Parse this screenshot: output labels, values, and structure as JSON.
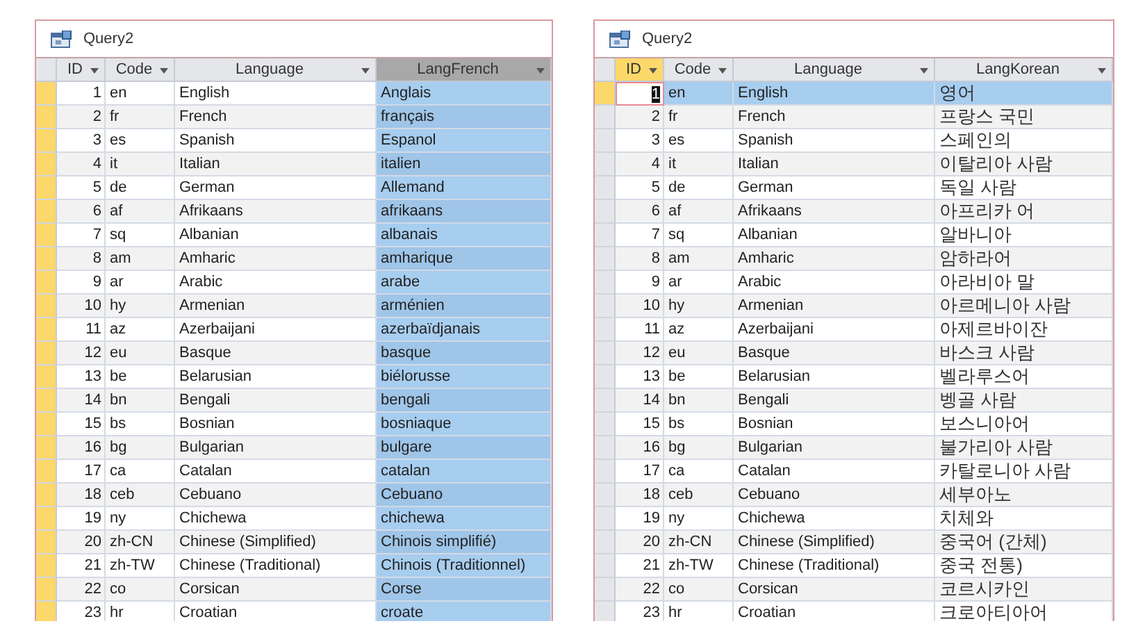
{
  "windows": [
    {
      "title": "Query2",
      "columns": [
        {
          "label": "ID",
          "selected": false,
          "current": false
        },
        {
          "label": "Code",
          "selected": false,
          "current": false
        },
        {
          "label": "Language",
          "selected": false,
          "current": false
        },
        {
          "label": "LangFrench",
          "selected": true,
          "current": false
        }
      ],
      "rows": [
        {
          "selected": false,
          "cells": [
            "1",
            "en",
            "English",
            "Anglais"
          ]
        },
        {
          "selected": false,
          "cells": [
            "2",
            "fr",
            "French",
            "français"
          ]
        },
        {
          "selected": false,
          "cells": [
            "3",
            "es",
            "Spanish",
            "Espanol"
          ]
        },
        {
          "selected": false,
          "cells": [
            "4",
            "it",
            "Italian",
            "italien"
          ]
        },
        {
          "selected": false,
          "cells": [
            "5",
            "de",
            "German",
            "Allemand"
          ]
        },
        {
          "selected": false,
          "cells": [
            "6",
            "af",
            "Afrikaans",
            "afrikaans"
          ]
        },
        {
          "selected": false,
          "cells": [
            "7",
            "sq",
            "Albanian",
            "albanais"
          ]
        },
        {
          "selected": false,
          "cells": [
            "8",
            "am",
            "Amharic",
            "amharique"
          ]
        },
        {
          "selected": false,
          "cells": [
            "9",
            "ar",
            "Arabic",
            "arabe"
          ]
        },
        {
          "selected": false,
          "cells": [
            "10",
            "hy",
            "Armenian",
            "arménien"
          ]
        },
        {
          "selected": false,
          "cells": [
            "11",
            "az",
            "Azerbaijani",
            "azerbaïdjanais"
          ]
        },
        {
          "selected": false,
          "cells": [
            "12",
            "eu",
            "Basque",
            "basque"
          ]
        },
        {
          "selected": false,
          "cells": [
            "13",
            "be",
            "Belarusian",
            "biélorusse"
          ]
        },
        {
          "selected": false,
          "cells": [
            "14",
            "bn",
            "Bengali",
            "bengali"
          ]
        },
        {
          "selected": false,
          "cells": [
            "15",
            "bs",
            "Bosnian",
            "bosniaque"
          ]
        },
        {
          "selected": false,
          "cells": [
            "16",
            "bg",
            "Bulgarian",
            "bulgare"
          ]
        },
        {
          "selected": false,
          "cells": [
            "17",
            "ca",
            "Catalan",
            "catalan"
          ]
        },
        {
          "selected": false,
          "cells": [
            "18",
            "ceb",
            "Cebuano",
            "Cebuano"
          ]
        },
        {
          "selected": false,
          "cells": [
            "19",
            "ny",
            "Chichewa",
            "chichewa"
          ]
        },
        {
          "selected": false,
          "cells": [
            "20",
            "zh-CN",
            "Chinese (Simplified)",
            "Chinois simplifié)"
          ]
        },
        {
          "selected": false,
          "cells": [
            "21",
            "zh-TW",
            "Chinese (Traditional)",
            "Chinois (Traditionnel)"
          ]
        },
        {
          "selected": false,
          "cells": [
            "22",
            "co",
            "Corsican",
            "Corse"
          ]
        },
        {
          "selected": false,
          "cells": [
            "23",
            "hr",
            "Croatian",
            "croate"
          ]
        }
      ]
    },
    {
      "title": "Query2",
      "columns": [
        {
          "label": "ID",
          "selected": false,
          "current": true
        },
        {
          "label": "Code",
          "selected": false,
          "current": false
        },
        {
          "label": "Language",
          "selected": false,
          "current": false
        },
        {
          "label": "LangKorean",
          "selected": false,
          "current": false
        }
      ],
      "rows": [
        {
          "selected": true,
          "cells": [
            "1",
            "en",
            "English",
            "영어"
          ]
        },
        {
          "selected": false,
          "cells": [
            "2",
            "fr",
            "French",
            "프랑스 국민"
          ]
        },
        {
          "selected": false,
          "cells": [
            "3",
            "es",
            "Spanish",
            "스페인의"
          ]
        },
        {
          "selected": false,
          "cells": [
            "4",
            "it",
            "Italian",
            "이탈리아 사람"
          ]
        },
        {
          "selected": false,
          "cells": [
            "5",
            "de",
            "German",
            "독일 사람"
          ]
        },
        {
          "selected": false,
          "cells": [
            "6",
            "af",
            "Afrikaans",
            "아프리카 어"
          ]
        },
        {
          "selected": false,
          "cells": [
            "7",
            "sq",
            "Albanian",
            "알바니아"
          ]
        },
        {
          "selected": false,
          "cells": [
            "8",
            "am",
            "Amharic",
            "암하라어"
          ]
        },
        {
          "selected": false,
          "cells": [
            "9",
            "ar",
            "Arabic",
            "아라비아 말"
          ]
        },
        {
          "selected": false,
          "cells": [
            "10",
            "hy",
            "Armenian",
            "아르메니아 사람"
          ]
        },
        {
          "selected": false,
          "cells": [
            "11",
            "az",
            "Azerbaijani",
            "아제르바이잔"
          ]
        },
        {
          "selected": false,
          "cells": [
            "12",
            "eu",
            "Basque",
            "바스크 사람"
          ]
        },
        {
          "selected": false,
          "cells": [
            "13",
            "be",
            "Belarusian",
            "벨라루스어"
          ]
        },
        {
          "selected": false,
          "cells": [
            "14",
            "bn",
            "Bengali",
            "벵골 사람"
          ]
        },
        {
          "selected": false,
          "cells": [
            "15",
            "bs",
            "Bosnian",
            "보스니아어"
          ]
        },
        {
          "selected": false,
          "cells": [
            "16",
            "bg",
            "Bulgarian",
            "불가리아 사람"
          ]
        },
        {
          "selected": false,
          "cells": [
            "17",
            "ca",
            "Catalan",
            "카탈로니아 사람"
          ]
        },
        {
          "selected": false,
          "cells": [
            "18",
            "ceb",
            "Cebuano",
            "세부아노"
          ]
        },
        {
          "selected": false,
          "cells": [
            "19",
            "ny",
            "Chichewa",
            "치체와"
          ]
        },
        {
          "selected": false,
          "cells": [
            "20",
            "zh-CN",
            "Chinese (Simplified)",
            "중국어 (간체)"
          ]
        },
        {
          "selected": false,
          "cells": [
            "21",
            "zh-TW",
            "Chinese (Traditional)",
            "중국 전통)"
          ]
        },
        {
          "selected": false,
          "cells": [
            "22",
            "co",
            "Corsican",
            "코르시카인"
          ]
        },
        {
          "selected": false,
          "cells": [
            "23",
            "hr",
            "Croatian",
            "크로아티아어"
          ]
        }
      ]
    }
  ]
}
